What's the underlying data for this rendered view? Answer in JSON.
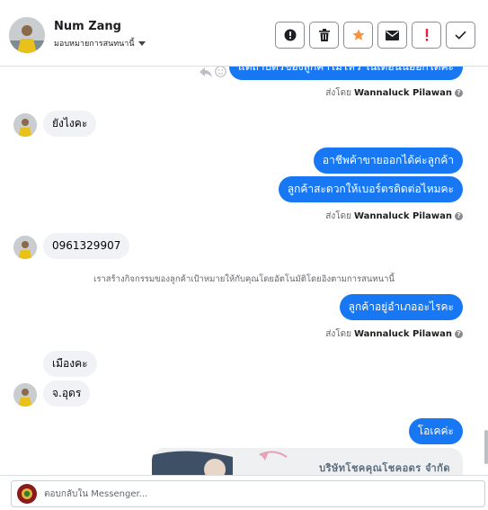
{
  "header": {
    "contact_name": "Num Zang",
    "assign_label": "มอบหมายการสนทนานี้",
    "toolbar": [
      {
        "name": "flag-info-button",
        "icon": "info-icon"
      },
      {
        "name": "delete-button",
        "icon": "trash-icon"
      },
      {
        "name": "star-button",
        "icon": "star-icon"
      },
      {
        "name": "mark-unread-button",
        "icon": "envelope-icon"
      },
      {
        "name": "spam-button",
        "icon": "exclamation-icon"
      },
      {
        "name": "done-button",
        "icon": "check-icon"
      }
    ]
  },
  "thread": {
    "top_cut_message": "แต่ถ้าบัตรของลูกค้าไม่ไหว ในเดือนนี้ออกได้คะ",
    "sent_prefix": "ส่งโดย",
    "agent_name": "Wannaluck Pilawan",
    "messages": {
      "m1": "ยังไงคะ",
      "m2": "อาชีพค้าขายออกได้ค่ะลูกค้า",
      "m3": "ลูกค้าสะดวกให้เบอร์ตรดิดต่อไหมคะ",
      "m4": "0961329907",
      "m5": "ลูกค้าอยู่อำเภออะไรคะ",
      "m6": "เมืองคะ",
      "m7": "จ.อุดร",
      "m8": "โอเคค่ะ"
    },
    "system_note": "เราสร้างกิจกรรมของลูกค้าเป้าหมายให้กับคุณโดยอัตโนมัติโดยอิงตามการสนทนานี้",
    "attachment_text": "บริษัทโชคคุณโชคอดร จำกัด"
  },
  "composer": {
    "placeholder": "ตอบกลับใน Messenger..."
  },
  "colors": {
    "accent": "#1877f2",
    "incoming_bubble": "#f0f2f5",
    "star": "#f7923a",
    "spam": "#e41e3f"
  }
}
